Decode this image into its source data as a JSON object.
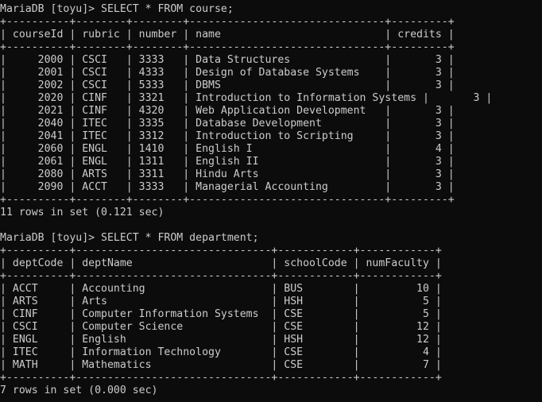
{
  "colors": {
    "background": "#0c0c0c",
    "text": "#cccccc"
  },
  "lines": [
    "MariaDB [toyu]> SELECT * FROM course;",
    "+----------+--------+--------+-------------------------------+---------+",
    "| courseId | rubric | number | name                          | credits |",
    "+----------+--------+--------+-------------------------------+---------+",
    "|     2000 | CSCI   | 3333   | Data Structures               |       3 |",
    "|     2001 | CSCI   | 4333   | Design of Database Systems    |       3 |",
    "|     2002 | CSCI   | 5333   | DBMS                          |       3 |",
    "|     2020 | CINF   | 3321   | Introduction to Information Systems |       3 |",
    "|     2021 | CINF   | 4320   | Web Application Development   |       3 |",
    "|     2040 | ITEC   | 3335   | Database Development          |       3 |",
    "|     2041 | ITEC   | 3312   | Introduction to Scripting     |       3 |",
    "|     2060 | ENGL   | 1410   | English I                     |       4 |",
    "|     2061 | ENGL   | 1311   | English II                    |       3 |",
    "|     2080 | ARTS   | 3311   | Hindu Arts                    |       3 |",
    "|     2090 | ACCT   | 3333   | Managerial Accounting         |       3 |",
    "+----------+--------+--------+-------------------------------+---------+",
    "11 rows in set (0.121 sec)",
    "",
    "MariaDB [toyu]> SELECT * FROM department;",
    "+----------+-------------------------------+------------+------------+",
    "| deptCode | deptName                      | schoolCode | numFaculty |",
    "+----------+-------------------------------+------------+------------+",
    "| ACCT     | Accounting                    | BUS        |         10 |",
    "| ARTS     | Arts                          | HSH        |          5 |",
    "| CINF     | Computer Information Systems  | CSE        |          5 |",
    "| CSCI     | Computer Science              | CSE        |         12 |",
    "| ENGL     | English                       | HSH        |         12 |",
    "| ITEC     | Information Technology        | CSE        |          4 |",
    "| MATH     | Mathematics                   | CSE        |          7 |",
    "+----------+-------------------------------+------------+------------+",
    "7 rows in set (0.000 sec)"
  ]
}
